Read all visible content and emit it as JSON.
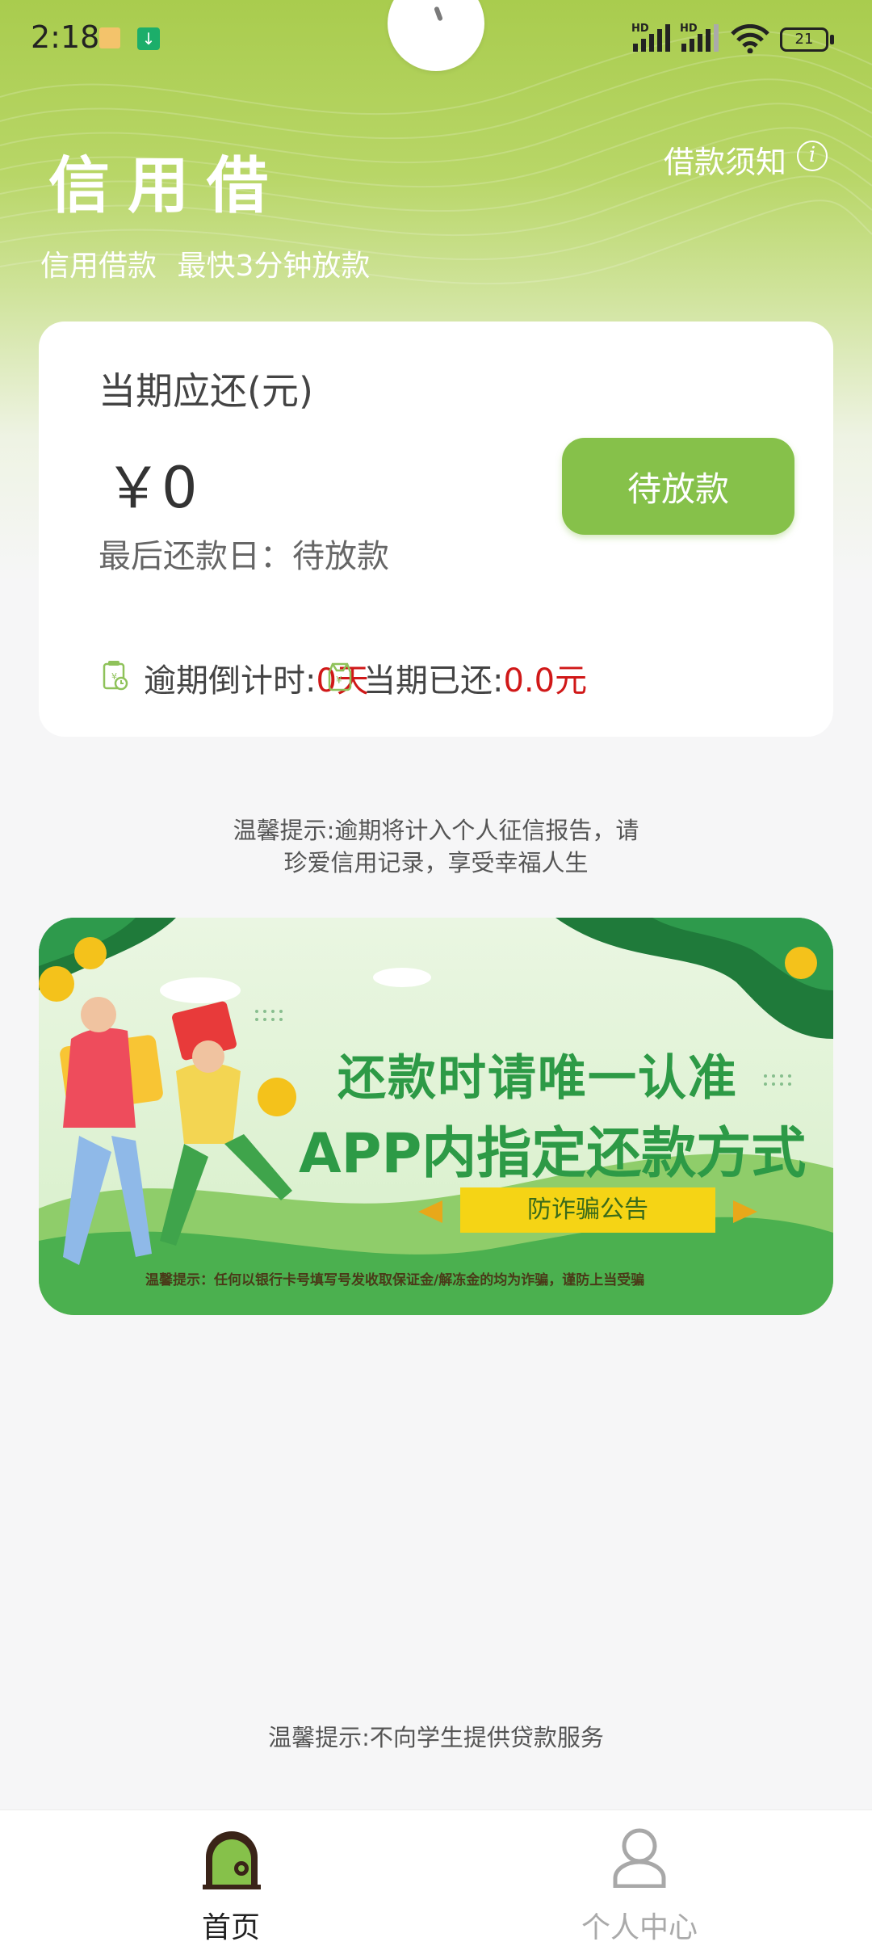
{
  "status_bar": {
    "time": "2:18",
    "battery": "21",
    "network_labels": [
      "HD",
      "HD"
    ]
  },
  "header": {
    "title": "信用借",
    "subtitle": "信用借款  最快3分钟放款",
    "notice_link": "借款须知",
    "info_glyph": "i"
  },
  "card": {
    "label": "当期应还(元)",
    "amount": "￥0",
    "due_date": "最后还款日：待放款",
    "button": "待放款",
    "overdue": {
      "label": "逾期倒计时:",
      "value": "0天"
    },
    "repaid": {
      "label": "当期已还:",
      "value": "0.0元"
    }
  },
  "tip_top": [
    "温馨提示:逾期将计入个人征信报告，请",
    "珍爱信用记录，享受幸福人生"
  ],
  "banner": {
    "line1": "还款时请唯一认准",
    "line2": "APP内指定还款方式",
    "ribbon": "防诈骗公告",
    "fine_print": "温馨提示：任何以银行卡号填写号发收取保证金/解冻金的均为诈骗，谨防上当受骗"
  },
  "tip_bottom": "温馨提示:不向学生提供贷款服务",
  "tabs": [
    {
      "label": "首页",
      "icon": "home-icon",
      "active": true
    },
    {
      "label": "个人中心",
      "icon": "user-icon",
      "active": false
    }
  ],
  "colors": {
    "primary": "#86c14a",
    "alert": "#d01818",
    "banner_text": "#2d9a46"
  }
}
